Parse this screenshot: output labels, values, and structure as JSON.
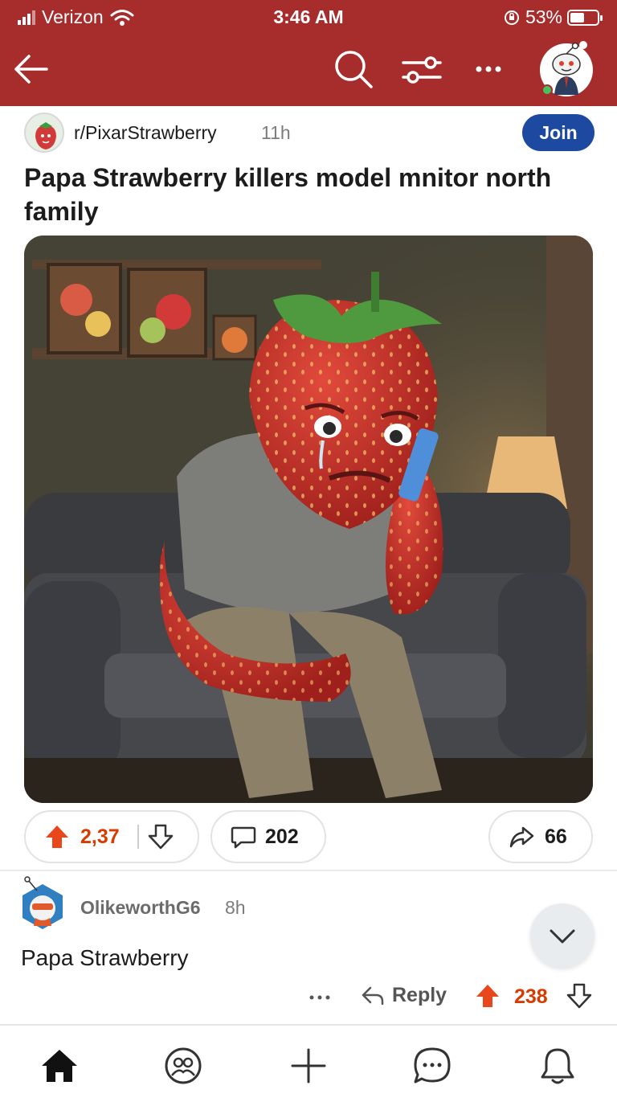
{
  "status_bar": {
    "carrier": "Verizon",
    "time": "3:46 AM",
    "battery": "53%",
    "battery_level": 0.53
  },
  "nav": {
    "icons": [
      "back-arrow-icon",
      "search-icon",
      "filter-icon",
      "more-icon",
      "profile-avatar"
    ]
  },
  "post": {
    "subreddit": "r/PixarStrawberry",
    "time": "11h",
    "join_label": "Join",
    "title": "Papa Strawberry killers model mnitor north family",
    "image_alt": "Pixar-style strawberry man crying on phone sitting on couch",
    "upvotes": "2,37",
    "comments": "202",
    "shares": "66"
  },
  "comment": {
    "username": "OlikeworthG6",
    "time": "8h",
    "text": "Papa Strawberry",
    "reply_label": "Reply",
    "score": "238"
  },
  "bottom_nav": [
    "home-icon",
    "communities-icon",
    "create-icon",
    "chat-icon",
    "notifications-icon"
  ],
  "colors": {
    "header_bg": "#a72c2c",
    "join_bg": "#1d4aa0",
    "upvote": "#d93a00",
    "text": "#1c1c1c",
    "muted": "#7c7c7c"
  }
}
